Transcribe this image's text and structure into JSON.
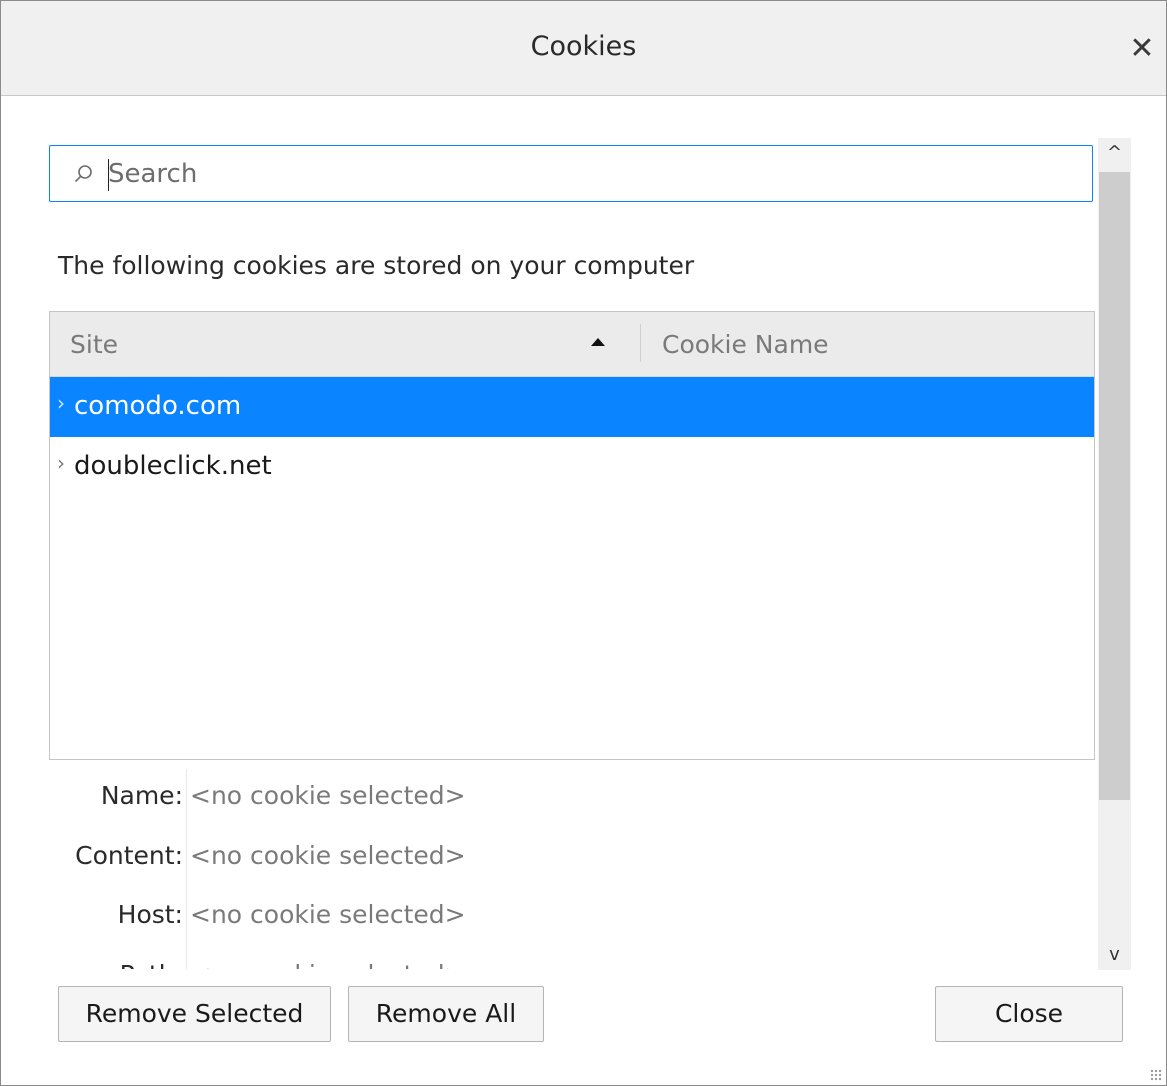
{
  "window": {
    "title": "Cookies",
    "close_glyph": "✕"
  },
  "search": {
    "placeholder": "Search",
    "icon": "search-icon"
  },
  "description": "The following cookies are stored on your computer",
  "table": {
    "columns": [
      "Site",
      "Cookie Name"
    ],
    "sorted_column": "Site",
    "sort_direction": "ascending",
    "rows": [
      {
        "site": "comodo.com",
        "selected": true
      },
      {
        "site": "doubleclick.net",
        "selected": false
      }
    ]
  },
  "details": [
    {
      "label": "Name:",
      "value": "<no cookie selected>"
    },
    {
      "label": "Content:",
      "value": "<no cookie selected>"
    },
    {
      "label": "Host:",
      "value": "<no cookie selected>"
    },
    {
      "label": "Path:",
      "value": "<no cookie selected>"
    }
  ],
  "buttons": {
    "remove_selected": "Remove Selected",
    "remove_all": "Remove All",
    "close": "Close"
  },
  "colors": {
    "accent": "#0a84ff",
    "header_bg": "#ebebeb",
    "titlebar_bg": "#f0f0f0"
  }
}
